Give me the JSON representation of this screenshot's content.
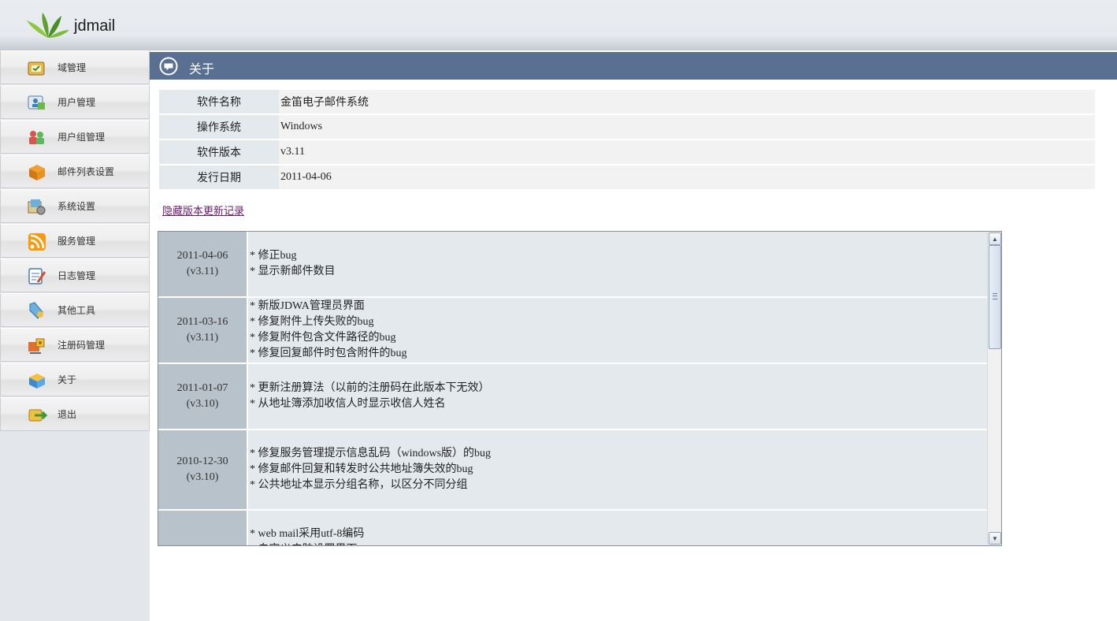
{
  "app": {
    "brand": "jdmail"
  },
  "sidebar": {
    "items": [
      {
        "label": "域管理",
        "icon": "domain-icon"
      },
      {
        "label": "用户管理",
        "icon": "user-icon"
      },
      {
        "label": "用户组管理",
        "icon": "user-group-icon"
      },
      {
        "label": "邮件列表设置",
        "icon": "mailing-list-icon"
      },
      {
        "label": "系统设置",
        "icon": "system-settings-icon"
      },
      {
        "label": "服务管理",
        "icon": "service-icon"
      },
      {
        "label": "日志管理",
        "icon": "log-icon"
      },
      {
        "label": "其他工具",
        "icon": "tools-icon"
      },
      {
        "label": "注册码管理",
        "icon": "registration-key-icon"
      },
      {
        "label": "关于",
        "icon": "about-icon"
      },
      {
        "label": "退出",
        "icon": "logout-icon"
      }
    ]
  },
  "main": {
    "title": "关于",
    "info": [
      {
        "key": "软件名称",
        "value": "金笛电子邮件系统"
      },
      {
        "key": "操作系统",
        "value": "Windows"
      },
      {
        "key": "软件版本",
        "value": "v3.11"
      },
      {
        "key": "发行日期",
        "value": "2011-04-06"
      }
    ],
    "history_link": "隐藏版本更新记录",
    "changelog": [
      {
        "date": "2011-04-06",
        "version": "(v3.11)",
        "notes": [
          "* 修正bug",
          "* 显示新邮件数目"
        ]
      },
      {
        "date": "2011-03-16",
        "version": "(v3.11)",
        "notes": [
          "* 新版JDWA管理员界面",
          "* 修复附件上传失败的bug",
          "* 修复附件包含文件路径的bug",
          "* 修复回复邮件时包含附件的bug"
        ]
      },
      {
        "date": "2011-01-07",
        "version": "(v3.10)",
        "notes": [
          "* 更新注册算法（以前的注册码在此版本下无效）",
          "* 从地址簿添加收信人时显示收信人姓名"
        ]
      },
      {
        "date": "2010-12-30",
        "version": "(v3.10)",
        "notes": [
          "* 修复服务管理提示信息乱码（windows版）的bug",
          "* 修复邮件回复和转发时公共地址簿失效的bug",
          "* 公共地址本显示分组名称，以区分不同分组"
        ]
      },
      {
        "date": "",
        "version": "",
        "notes": [
          "* web mail采用utf-8编码",
          "* 自定义皮肤设置界面"
        ]
      }
    ]
  },
  "colors": {
    "title_bar": "#5a7093",
    "key_cell": "#e4e9ee",
    "date_cell": "#b8c2ca",
    "link": "#6a1a6a"
  }
}
